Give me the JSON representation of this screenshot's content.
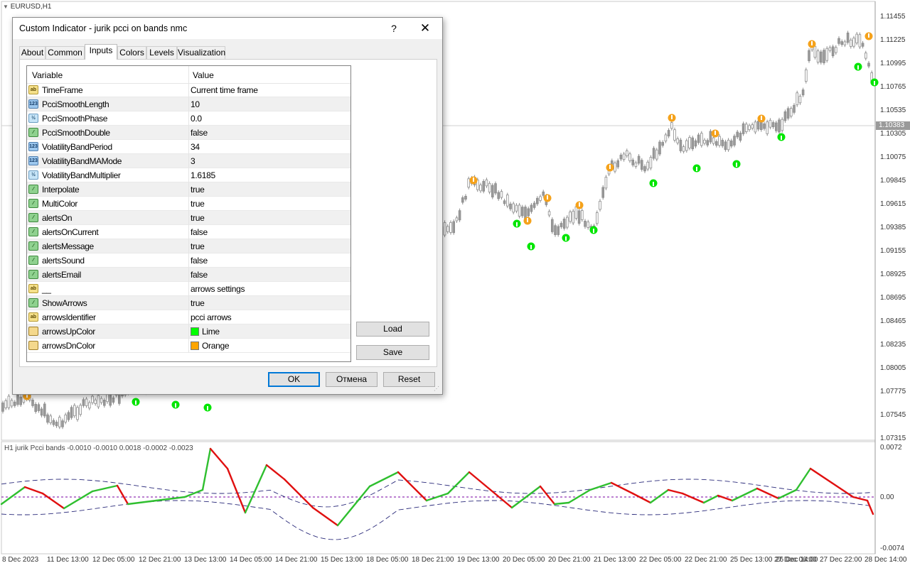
{
  "chart": {
    "symbol_label": "EURUSD,H1",
    "current_price": "1.10383",
    "price_labels": [
      "1.11455",
      "1.11225",
      "1.10995",
      "1.10765",
      "1.10535",
      "1.10305",
      "1.10075",
      "1.09845",
      "1.09615",
      "1.09385",
      "1.09155",
      "1.08925",
      "1.08695",
      "1.08465",
      "1.08235",
      "1.08005",
      "1.07775",
      "1.07545",
      "1.07315"
    ],
    "time_labels": [
      "8 Dec 2023",
      "11 Dec 13:00",
      "12 Dec 05:00",
      "12 Dec 21:00",
      "13 Dec 13:00",
      "14 Dec 05:00",
      "14 Dec 21:00",
      "15 Dec 13:00",
      "18 Dec 05:00",
      "18 Dec 21:00",
      "19 Dec 13:00",
      "20 Dec 05:00",
      "20 Dec 21:00",
      "21 Dec 13:00",
      "22 Dec 05:00",
      "22 Dec 21:00",
      "25 Dec 13:00",
      "26 Dec 14:00",
      "27 Dec 06:00",
      "27 Dec 22:00",
      "28 Dec 14:00"
    ],
    "indicator_label": "H1 jurik Pcci bands  -0.0010 -0.0010 0.0018 -0.0002 -0.0023",
    "indicator_ticks": [
      "0.0072",
      "0.00",
      "-0.0074"
    ],
    "colors": {
      "up_arrow": "#00e600",
      "down_arrow": "#f5a21b",
      "candle": "#8c8c8c",
      "osc_up": "#2fbf2f",
      "osc_down": "#e01010",
      "band": "#2a2a7a"
    }
  },
  "dialog": {
    "title": "Custom Indicator - jurik pcci on bands nmc",
    "help_glyph": "?",
    "close_glyph": "✕",
    "tabs": [
      "About",
      "Common",
      "Inputs",
      "Colors",
      "Levels",
      "Visualization"
    ],
    "active_tab": "Inputs",
    "grid": {
      "col_variable": "Variable",
      "col_value": "Value",
      "rows": [
        {
          "icon": "ab",
          "name": "TimeFrame",
          "value": "Current time frame"
        },
        {
          "icon": "123",
          "name": "PcciSmoothLength",
          "value": "10"
        },
        {
          "icon": "½",
          "name": "PcciSmoothPhase",
          "value": "0.0"
        },
        {
          "icon": "bool",
          "name": "PcciSmoothDouble",
          "value": "false"
        },
        {
          "icon": "123",
          "name": "VolatilityBandPeriod",
          "value": "34"
        },
        {
          "icon": "123",
          "name": "VolatilityBandMAMode",
          "value": "3"
        },
        {
          "icon": "½",
          "name": "VolatilityBandMultiplier",
          "value": "1.6185"
        },
        {
          "icon": "bool",
          "name": "Interpolate",
          "value": "true"
        },
        {
          "icon": "bool",
          "name": "MultiColor",
          "value": "true"
        },
        {
          "icon": "bool",
          "name": "alertsOn",
          "value": "true"
        },
        {
          "icon": "bool",
          "name": "alertsOnCurrent",
          "value": "false"
        },
        {
          "icon": "bool",
          "name": "alertsMessage",
          "value": "true"
        },
        {
          "icon": "bool",
          "name": "alertsSound",
          "value": "false"
        },
        {
          "icon": "bool",
          "name": "alertsEmail",
          "value": "false"
        },
        {
          "icon": "ab",
          "name": "__",
          "value": "arrows settings"
        },
        {
          "icon": "bool",
          "name": "ShowArrows",
          "value": "true"
        },
        {
          "icon": "ab",
          "name": "arrowsIdentifier",
          "value": "pcci arrows"
        },
        {
          "icon": "color",
          "name": "arrowsUpColor",
          "value": "Lime",
          "swatch": "#00ff00"
        },
        {
          "icon": "color",
          "name": "arrowsDnColor",
          "value": "Orange",
          "swatch": "#ffa500"
        }
      ]
    },
    "buttons": {
      "load": "Load",
      "save": "Save",
      "ok": "OK",
      "cancel": "Отмена",
      "reset": "Reset"
    }
  }
}
